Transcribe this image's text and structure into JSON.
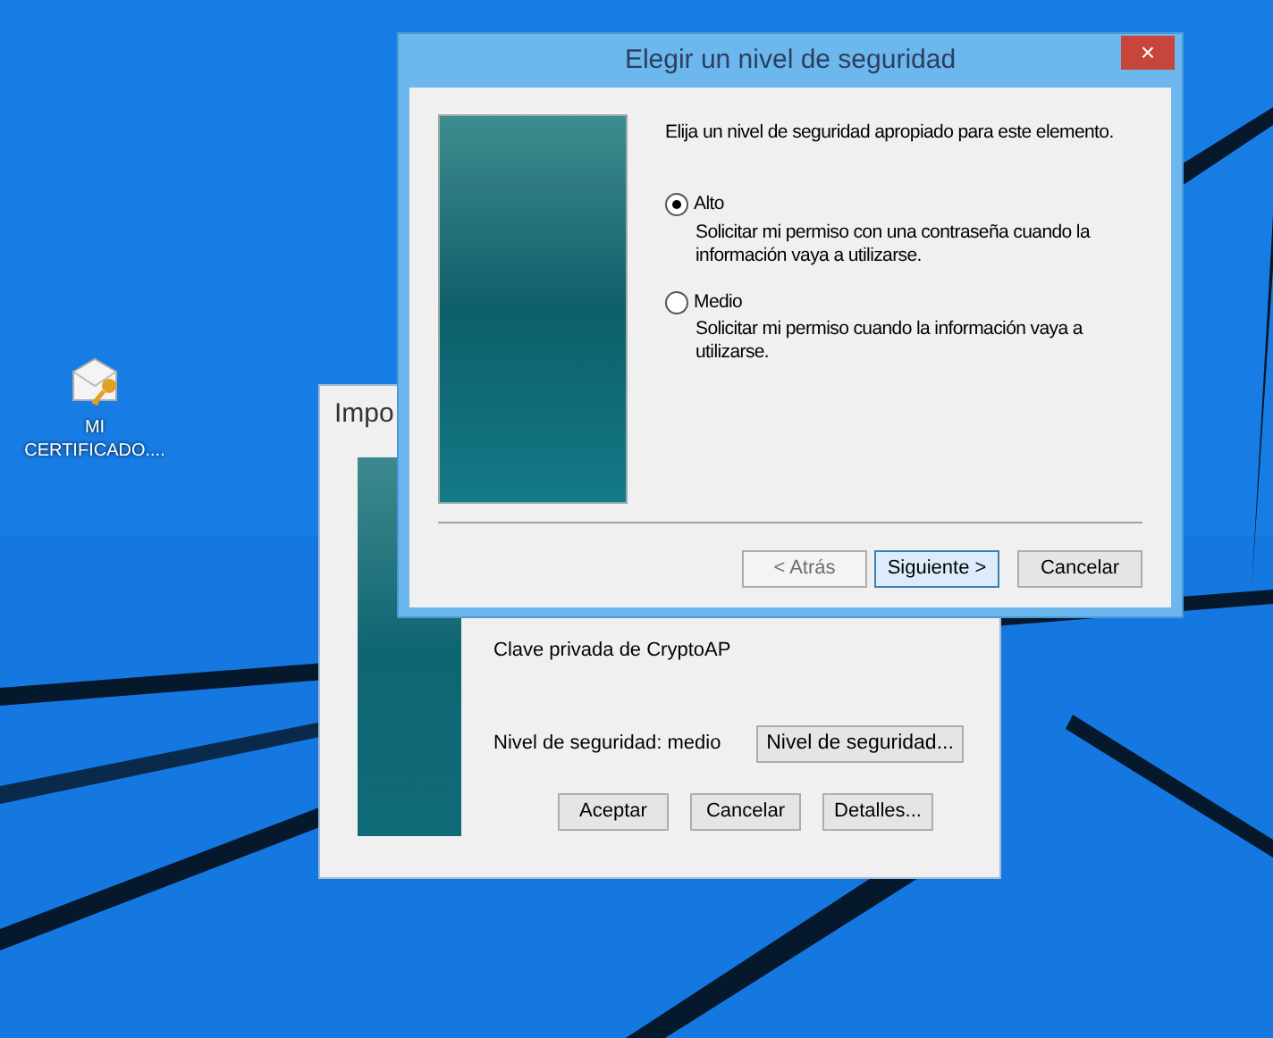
{
  "desktop_icon": {
    "label": "MI CERTIFICADO...."
  },
  "back_window": {
    "title": "Impo",
    "item": "Clave privada de CryptoAP",
    "security_level": "Nivel de seguridad: medio",
    "security_button": "Nivel de seguridad...",
    "buttons": [
      {
        "label": "Aceptar"
      },
      {
        "label": "Cancelar"
      },
      {
        "label": "Detalles..."
      }
    ]
  },
  "dialog": {
    "title": "Elegir un nivel de seguridad",
    "close": "×",
    "intro": "Elija un nivel de seguridad apropiado para este elemento.",
    "options": [
      {
        "label": "Alto",
        "description": "Solicitar mi permiso con una contraseña cuando la información vaya a utilizarse.",
        "selected": true
      },
      {
        "label": "Medio",
        "description": "Solicitar mi permiso cuando la información vaya a utilizarse.",
        "selected": false
      }
    ],
    "buttons": [
      {
        "label": "< Atrás",
        "disabled": true,
        "default": false
      },
      {
        "label": "Siguiente >",
        "disabled": false,
        "default": true
      },
      {
        "label": "Cancelar",
        "disabled": false,
        "default": false
      }
    ]
  }
}
